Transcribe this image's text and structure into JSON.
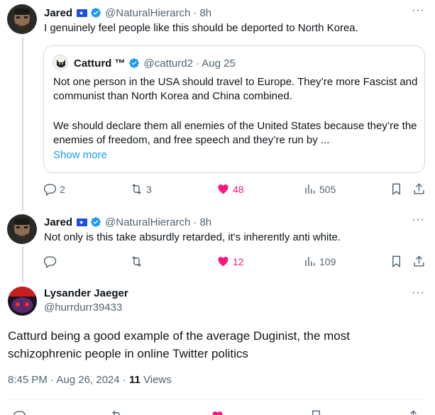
{
  "tweet1": {
    "name": "Jared",
    "handle": "@NaturalHierarch",
    "time": "· 8h",
    "text": "I genuinely feel people like this should be deported to North Korea.",
    "quote": {
      "name": "Catturd ™",
      "handle": "@catturd2",
      "time": "· Aug 25",
      "text1": "Not one person in the USA should travel to Europe. They’re more Fascist and communist than North Korea and China combined.",
      "text2": "We should declare them all enemies of the United States because they’re the enemies of freedom, and free speech and they’re run by ...",
      "show_more": "Show more"
    },
    "replies": "2",
    "reposts": "3",
    "likes": "48",
    "views": "505"
  },
  "tweet2": {
    "name": "Jared",
    "handle": "@NaturalHierarch",
    "time": "· 8h",
    "text": "Not only is this take absurdly retarded, it's inherently anti white.",
    "likes": "12",
    "views": "109"
  },
  "main": {
    "name": "Lysander Jaeger",
    "handle": "@hurrdurr39433",
    "text": "Catturd being a good example of the average Duginist, the most schizophrenic people in online Twitter politics",
    "timestamp": "8:45 PM · Aug 26, 2024 · ",
    "views_count": "11",
    "views_label": " Views"
  },
  "more_label": "···",
  "colors": {
    "accent": "#1d9bf0",
    "like": "#f91880",
    "muted": "#536471",
    "border": "#cfd9de"
  }
}
